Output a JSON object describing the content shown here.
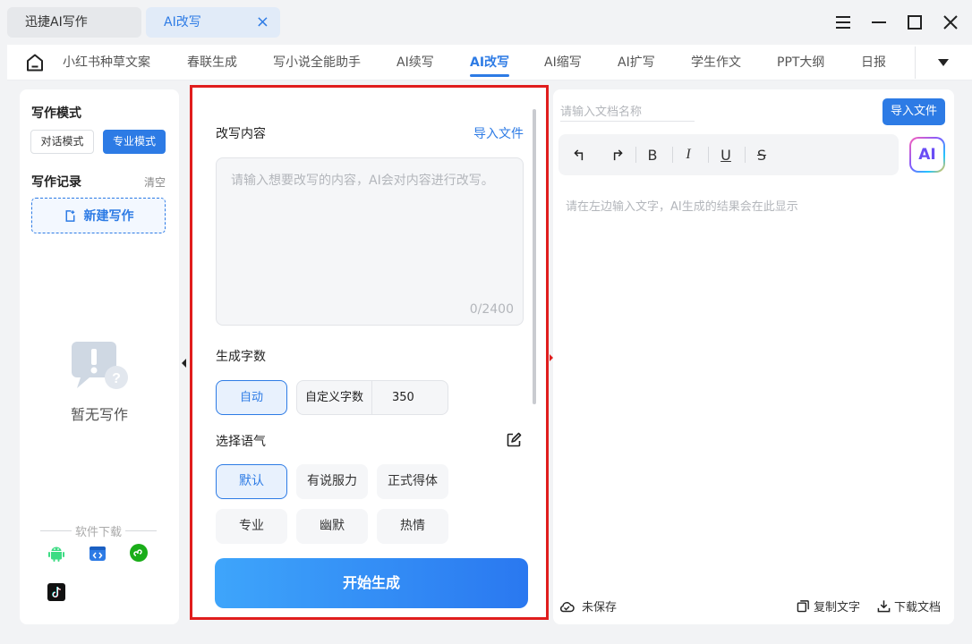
{
  "window": {
    "tabs": [
      {
        "label": "迅捷AI写作"
      },
      {
        "label": "AI改写",
        "close_icon": "×"
      }
    ]
  },
  "nav": {
    "items": [
      "小红书种草文案",
      "春联生成",
      "写小说全能助手",
      "AI续写",
      "AI改写",
      "AI缩写",
      "AI扩写",
      "学生作文",
      "PPT大纲",
      "日报"
    ],
    "active": "AI改写"
  },
  "left": {
    "mode_label": "写作模式",
    "mode_chat": "对话模式",
    "mode_pro": "专业模式",
    "record_label": "写作记录",
    "clear": "清空",
    "new_button": "新建写作",
    "empty_text": "暂无写作",
    "download_label": "软件下载"
  },
  "editor": {
    "title": "改写内容",
    "import": "导入文件",
    "placeholder": "请输入想要改写的内容，AI会对内容进行改写。",
    "counter": "0/2400",
    "words_label": "生成字数",
    "auto": "自动",
    "custom_label": "自定义字数",
    "custom_value": "350",
    "tone_label": "选择语气",
    "tones": [
      "默认",
      "有说服力",
      "正式得体",
      "专业",
      "幽默",
      "热情"
    ],
    "selected_tone": "默认",
    "generate": "开始生成"
  },
  "output": {
    "doc_name_placeholder": "请输入文档名称",
    "import_button": "导入文件",
    "toolbar": [
      "undo-icon",
      "redo-icon",
      "bold-icon",
      "italic-icon",
      "underline-icon",
      "strikethrough-icon"
    ],
    "toolbar_glyphs": {
      "bold": "B",
      "italic": "I",
      "underline": "U",
      "strike": "S"
    },
    "ai_button": "AI",
    "placeholder": "请在左边输入文字，AI生成的结果会在此显示",
    "save_status": "未保存",
    "copy_text": "复制文字",
    "download_doc": "下载文档"
  },
  "colors": {
    "accent": "#2d7be5",
    "highlight_border": "#e01d1d"
  }
}
